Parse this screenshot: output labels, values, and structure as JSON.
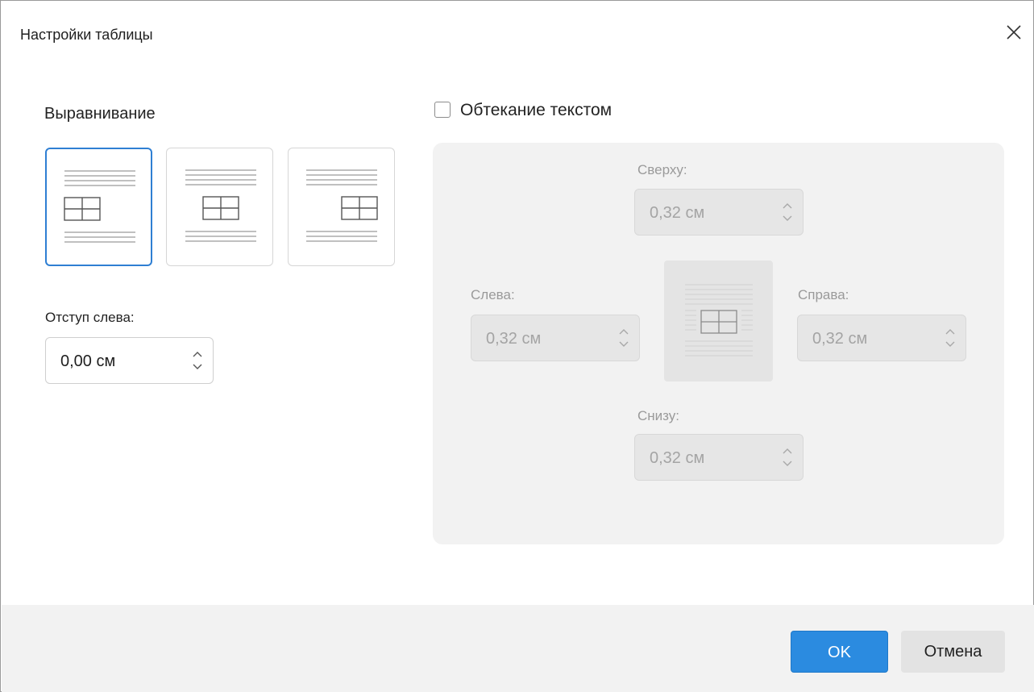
{
  "dialog": {
    "title": "Настройки таблицы",
    "close_icon": "close-icon"
  },
  "alignment": {
    "label": "Выравнивание",
    "options": [
      "left",
      "center",
      "right"
    ],
    "selected": "left"
  },
  "indent": {
    "label": "Отступ слева:",
    "value": "0,00 см"
  },
  "wrap": {
    "checkbox_label": "Обтекание текстом",
    "checked": false,
    "top_label": "Сверху:",
    "top_value": "0,32 см",
    "left_label": "Слева:",
    "left_value": "0,32 см",
    "right_label": "Справа:",
    "right_value": "0,32 см",
    "bottom_label": "Снизу:",
    "bottom_value": "0,32 см"
  },
  "footer": {
    "ok_label": "OK",
    "cancel_label": "Отмена"
  },
  "colors": {
    "accent": "#2b8be0",
    "selected_border": "#2f7fd3",
    "panel_bg": "#f2f2f2",
    "disabled_text": "#a4a4a4"
  }
}
